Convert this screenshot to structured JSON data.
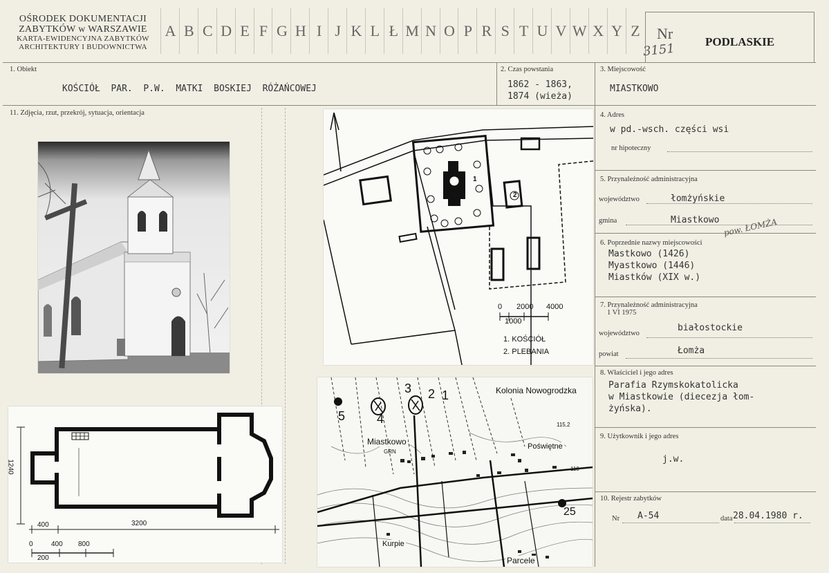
{
  "header": {
    "org_line1": "OŚRODEK DOKUMENTACJI",
    "org_line2": "ZABYTKÓW w WARSZAWIE",
    "org_line3": "KARTA-EWIDENCYJNA ZABYTKÓW",
    "org_line4": "ARCHITEKTURY I BUDOWNICTWA",
    "letters": [
      "A",
      "B",
      "C",
      "D",
      "E",
      "F",
      "G",
      "H",
      "I",
      "J",
      "K",
      "L",
      "Ł",
      "M",
      "N",
      "O",
      "P",
      "R",
      "S",
      "T",
      "U",
      "V",
      "W",
      "X",
      "Y",
      "Z"
    ],
    "nr_label": "Nr",
    "nr_value": "3151",
    "region": "PODLASKIE"
  },
  "obiekt": {
    "label": "1. Obiekt",
    "value": "KOŚCIÓŁ  PAR.  P.W.  MATKI  BOSKIEJ  RÓŻAŃCOWEJ"
  },
  "czas": {
    "label": "2. Czas powstania",
    "line1": "1862 - 1863,",
    "line2": "1874 (wieża)"
  },
  "miejscowosc": {
    "label": "3. Miejscowość",
    "value": "MIASTKOWO"
  },
  "zdjecia": {
    "label": "11. Zdjęcia, rzut, przekrój, sytuacja, orientacja"
  },
  "adres": {
    "label": "4. Adres",
    "value": "w pd.-wsch. części wsi",
    "hipoteczny_label": "nr hipoteczny"
  },
  "przynaleznosc": {
    "label": "5. Przynależność administracyjna",
    "woj_label": "województwo",
    "woj_value": "łomżyńskie",
    "gmina_label": "gmina",
    "gmina_value": "Miastkowo",
    "powiat_note": "pow. ŁOMŻA"
  },
  "poprzednie": {
    "label": "6. Poprzednie nazwy miejscowości",
    "line1": "Mastkowo (1426)",
    "line2": "Myastkowo (1446)",
    "line3": "Miastków (XIX w.)"
  },
  "przynaleznosc_1975": {
    "label": "7. Przynależność administracyjna",
    "sub": "1 VI 1975",
    "woj_label": "województwo",
    "woj_value": "białostockie",
    "powiat_label": "powiat",
    "powiat_value": "Łomża"
  },
  "wlasciciel": {
    "label": "8. Właściciel i jego adres",
    "line1": "Parafia Rzymskokatolicka",
    "line2": "w Miastkowie (diecezja łom-",
    "line3": "żyńska)."
  },
  "uzytkownik": {
    "label": "9. Użytkownik i jego adres",
    "value": "j.w."
  },
  "rejestr": {
    "label": "10. Rejestr zabytków",
    "nr_label": "Nr",
    "nr_value": "A-54",
    "data_label": "data",
    "data_value": "28.04.1980 r."
  },
  "site_plan": {
    "scale_0": "0",
    "scale_2000": "2000",
    "scale_4000": "4000",
    "scale_1000": "1000",
    "legend1": "1. KOŚCIÓŁ",
    "legend2": "2. PLEBANIA",
    "mark1": "1",
    "mark2": "2"
  },
  "floor_plan": {
    "dim_1240": "1240",
    "dim_3200": "3200",
    "dim_400": "400",
    "scale_0": "0",
    "scale_400": "400",
    "scale_800": "800",
    "scale_200": "200"
  },
  "topo_map": {
    "kolonia": "Kolonia Nowogrodzka",
    "miastkowo": "Miastkowo",
    "grn": "GRN",
    "poswietne": "Poświętne",
    "kurpie": "Kurpie",
    "parcele": "Parcele",
    "elev": "115,2",
    "n5": "5",
    "n4": "4",
    "n3": "3",
    "n2": "2",
    "n1": "1",
    "n25": "25",
    "n110": "110"
  }
}
